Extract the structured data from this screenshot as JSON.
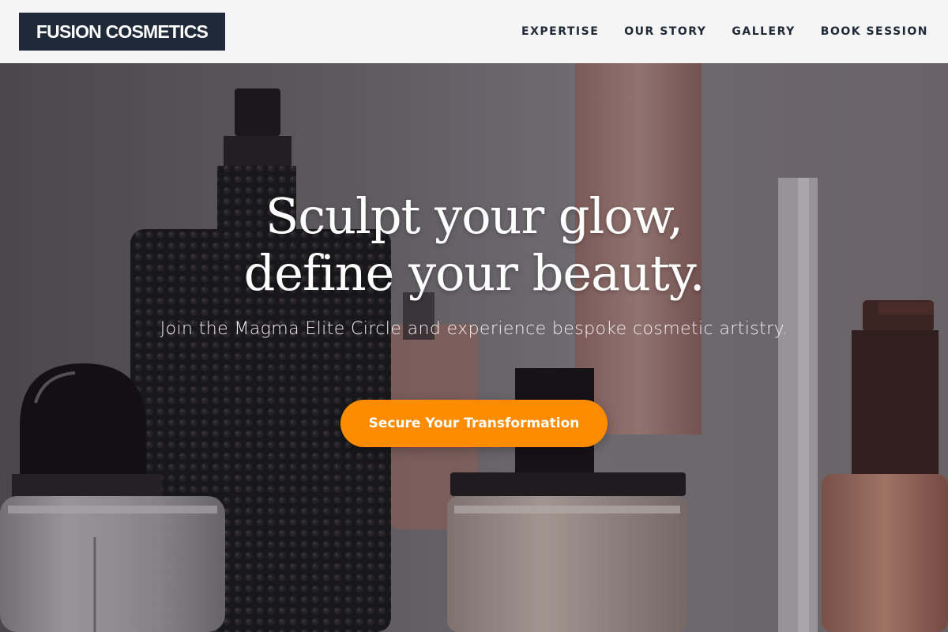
{
  "header": {
    "logo": "FUSION COSMETICS",
    "nav": [
      {
        "label": "EXPERTISE"
      },
      {
        "label": "OUR STORY"
      },
      {
        "label": "GALLERY"
      },
      {
        "label": "BOOK SESSION"
      }
    ]
  },
  "hero": {
    "headline_line1": "Sculpt your glow,",
    "headline_line2": "define your beauty.",
    "subtext": "Join the Magma Elite Circle and experience bespoke cosmetic artistry.",
    "cta_label": "Secure Your Transformation",
    "background_image": "cosmetic-bottles-photo"
  },
  "colors": {
    "logo_bg": "#1f2937",
    "nav_text": "#1f2937",
    "header_bg": "#f5f5f5",
    "cta_bg": "#ff8c00",
    "headline_text": "#ffffff"
  }
}
